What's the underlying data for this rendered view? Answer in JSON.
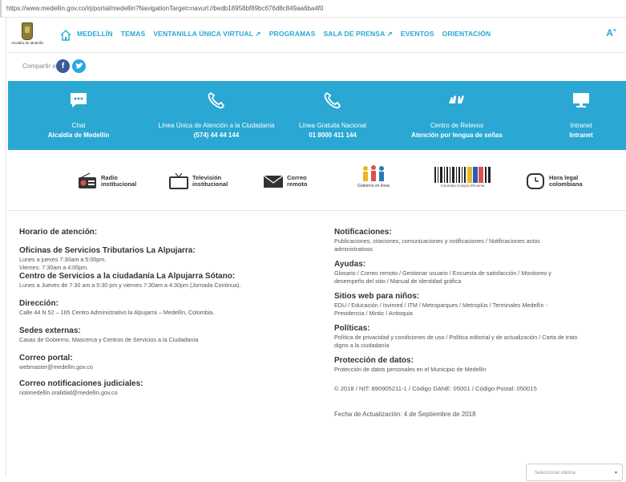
{
  "url": "https://www.medellin.gov.co/irj/portal/medellin?NavigationTarget=navurl://bedb18958bf89bc676d8c849aa6ba4f0",
  "logo_text": "Alcaldía de Medellín",
  "nav": [
    "MEDELLÍN",
    "TEMAS",
    "VENTANILLA ÚNICA VIRTUAL ↗",
    "PROGRAMAS",
    "SALA DE PRENSA ↗",
    "EVENTOS",
    "ORIENTACIÓN"
  ],
  "a11y": "A",
  "a11y_sup": "+",
  "share_label": "Compartir en:",
  "social": {
    "fb": "f",
    "tw": "t"
  },
  "contacts": [
    {
      "icon": "chat-icon",
      "line1": "Chat",
      "line2": "Alcaldía de Medellín"
    },
    {
      "icon": "phone-icon",
      "line1": "Línea Única de Atención a la Ciudadanía",
      "line2": "(574) 44 44 144"
    },
    {
      "icon": "phone-icon",
      "line1": "Línea Gratuita Nacional",
      "line2": "01 8000 411 144"
    },
    {
      "icon": "sign-language-icon",
      "line1": "Centro de Relevos",
      "line2": "Atención por lengua de señas"
    },
    {
      "icon": "monitor-icon",
      "line1": "Intranet",
      "line2": "Intranet"
    }
  ],
  "media": [
    {
      "icon": "radio-icon",
      "text": "Radio\ninstitucional"
    },
    {
      "icon": "tv-icon",
      "text": "Televisión\ninstitucional"
    },
    {
      "icon": "mail-icon",
      "text": "Correo\nremoto"
    },
    {
      "icon": "gobierno-en-linea-logo",
      "text": "Gobierno en línea"
    },
    {
      "icon": "colombia-compra-logo",
      "text": "Colombia Compra Eficiente"
    },
    {
      "icon": "clock-icon",
      "text": "Hora legal\ncolombiana"
    }
  ],
  "left": {
    "title": "Horario de atención:",
    "oficinas_title": "Oficinas de Servicios Tributarios La Alpujarra:",
    "oficinas_l1": "Lunes a jueves 7:30am a 5:00pm.",
    "oficinas_l2": "Viernes: 7:30am a 4:00pm.",
    "centro_title": "Centro de Servicios a la ciudadanía La Alpujarra Sótano:",
    "centro_l1": "Lunes a Jueves de 7:30 am a 5:30 pm y viernes 7:30am a 4:30pm (Jornada Continua).",
    "direccion_title": "Dirección:",
    "direccion_l1": "Calle 44 N 52 – 165 Centro Administrativo la Alpujarra – Medellín, Colombia.",
    "sedes_title": "Sedes externas:",
    "sedes_l1": "Casas de Gobierno, Mascerca y Centros de Servicios a la Ciudadanía",
    "correo_title": "Correo portal:",
    "correo_l1": "webmaster@medellin.gov.co",
    "judiciales_title": "Correo notificaciones judiciales:",
    "judiciales_l1": "notimedellin.oralidad@medellin.gov.co"
  },
  "right": {
    "notif_title": "Notificaciones:",
    "notif_l1": "Publicaciones, citaciones, comunicaciones y notificaciones / Notificaciones actos",
    "notif_l2": "administrativos",
    "ayudas_title": "Ayudas:",
    "ayudas_l1": "Glosario / Correo remoto / Gestionar usuario / Encuesta de satisfacción / Monitoreo y",
    "ayudas_l2": "desempeño del sitio / Manual de identidad gráfica",
    "sitios_title": "Sitios web para niños:",
    "sitios_l1": "EDU / Educación / Isvimed / ITM / Metroparques / Metroplús / Terminales Medellín -",
    "sitios_l2": "Presidencia / Mintic / Antioquia",
    "politicas_title": "Políticas:",
    "politicas_l1": "Política de privacidad y condiciones de uso / Política editorial y de actualización / Carta de trato",
    "politicas_l2": "digno a la ciudadanía",
    "proteccion_title": "Protección de datos:",
    "proteccion_l1": "Protección de datos personales en el Municipio de Medellín",
    "copyright": "© 2018 / NIT: 890905211-1 / Código DANE: 05001 / Código Postal: 050015",
    "fecha": "Fecha de Actualización: 4 de Septiembre de 2018"
  },
  "select": {
    "placeholder": "Seleccionar idioma"
  }
}
